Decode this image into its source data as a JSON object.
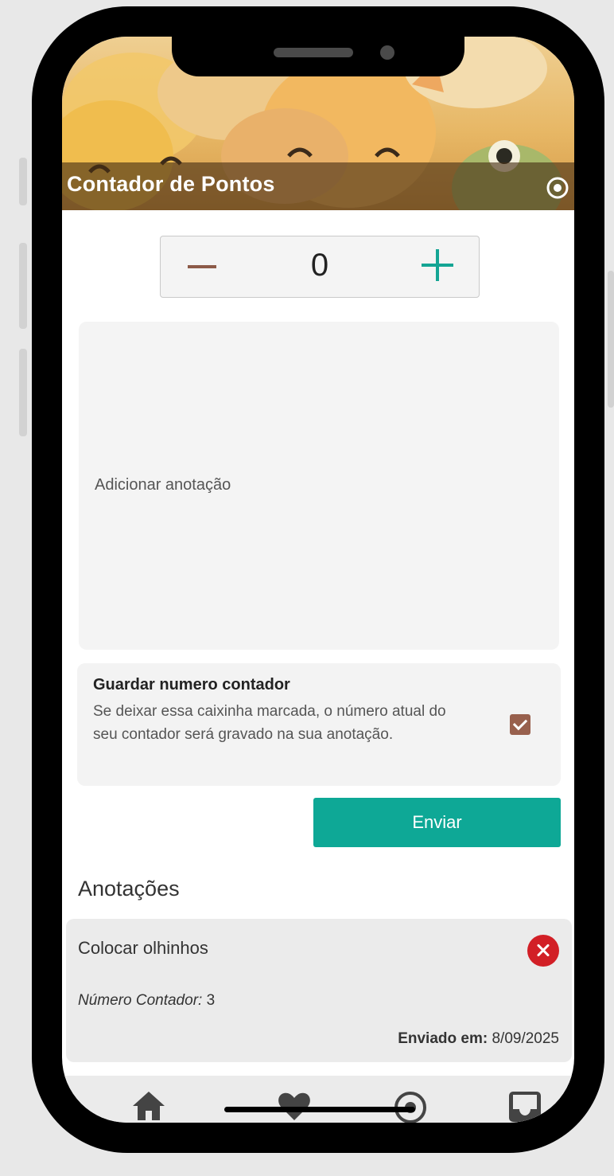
{
  "header": {
    "title": "Contador de Pontos",
    "settings_icon": "record-circle-icon",
    "banner_colors": [
      "#efcf92",
      "#e7b765",
      "#d59a48"
    ]
  },
  "counter": {
    "value": "0",
    "minus_icon": "minus-icon",
    "plus_icon": "plus-icon",
    "minus_color": "#8c5a48",
    "plus_color": "#14a594"
  },
  "note_input": {
    "placeholder": "Adicionar anotação"
  },
  "save_counter": {
    "title": "Guardar numero contador",
    "description": "Se deixar essa caixinha marcada, o número atual do seu contador será gravado na sua anotação.",
    "checked": true,
    "checkbox_color": "#98604d"
  },
  "send_button": {
    "label": "Enviar",
    "color": "#0ea896"
  },
  "notes_section": {
    "title": "Anotações",
    "items": [
      {
        "text": "Colocar olhinhos",
        "counter_label": "Número Contador:",
        "counter_value": "3",
        "sent_label": "Enviado em:",
        "sent_date": "8/09/2025",
        "delete_icon": "close-circle-icon",
        "delete_color": "#d21f26"
      }
    ]
  },
  "bottom_nav": {
    "items": [
      {
        "icon": "home-icon"
      },
      {
        "icon": "heart-icon"
      },
      {
        "icon": "record-circle-icon"
      },
      {
        "icon": "inbox-icon"
      }
    ]
  }
}
